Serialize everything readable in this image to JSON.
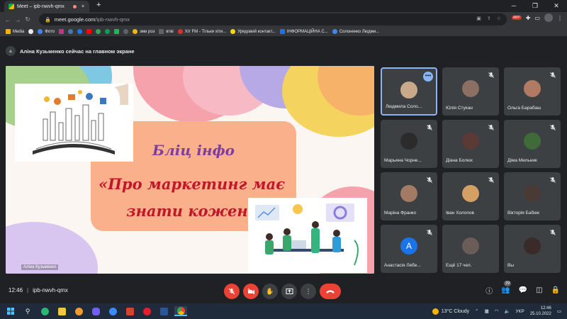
{
  "browser": {
    "tab_title": "Meet – ipb-nwvh-qmx",
    "tab_close": "×",
    "new_tab": "+",
    "url_host": "meet.google.com",
    "url_path": "/ipb-nwvh-qmx",
    "window_controls": [
      "─",
      "❐",
      "✕"
    ],
    "ext_badge": "ABP"
  },
  "bookmarks": [
    {
      "label": "Media",
      "color": "#f4b400"
    },
    {
      "label": "",
      "color": "#e8eaed"
    },
    {
      "label": "Фото",
      "color": "#4285f4"
    },
    {
      "label": "",
      "color": "#c13584"
    },
    {
      "label": "",
      "color": "#4a76a8"
    },
    {
      "label": "",
      "color": "#1877f2"
    },
    {
      "label": "",
      "color": "#ff0000"
    },
    {
      "label": "",
      "color": "#34a853"
    },
    {
      "label": "",
      "color": "#0f9d58"
    },
    {
      "label": "",
      "color": "#1db954"
    },
    {
      "label": "",
      "color": "#5f6368"
    },
    {
      "label": "зми роз",
      "color": "#f4b400"
    },
    {
      "label": "втві",
      "color": "#5f6368"
    },
    {
      "label": "Хіт FM - Тільки хіти...",
      "color": "#d93025"
    },
    {
      "label": "Урядовий контакт...",
      "color": "#ffd700"
    },
    {
      "label": "ІНФОРМАЦІЙНА С...",
      "color": "#1a73e8"
    },
    {
      "label": "Солоненко Людми...",
      "color": "#4285f4"
    }
  ],
  "meet": {
    "presenter_text": "Аліна Кузьменко сейчас на главном экране",
    "slide": {
      "title_line1": "Бліц інфо",
      "title_line2": "«Про маркетинг має",
      "title_line3": "знати кожен»",
      "caption": "Аліна Кузьменко"
    },
    "participants": [
      {
        "name": "Людмила Соло...",
        "face": "#c9a98a",
        "active": true,
        "muted": false
      },
      {
        "name": "Юлія Стукан",
        "face": "#8a6f62",
        "active": false,
        "muted": true
      },
      {
        "name": "Ольга Барабаш",
        "face": "#b07a63",
        "active": false,
        "muted": true
      },
      {
        "name": "Марьяна Чорне...",
        "face": "#2b2b2b",
        "active": false,
        "muted": true
      },
      {
        "name": "Діана Болюх",
        "face": "#5b3a35",
        "active": false,
        "muted": true
      },
      {
        "name": "Діма Мельник",
        "face": "#3f6b3a",
        "active": false,
        "muted": true
      },
      {
        "name": "Маріна Франко",
        "face": "#a37b64",
        "active": false,
        "muted": true
      },
      {
        "name": "Іван Холопов",
        "face": "#d4a064",
        "active": false,
        "muted": true
      },
      {
        "name": "Вікторія Бабюк",
        "face": "#4a3a35",
        "active": false,
        "muted": true
      },
      {
        "name": "Анастасія Лебе...",
        "letter": "A",
        "active": false,
        "muted": true
      },
      {
        "name": "Ещё 17 чел.",
        "face": "#6b5c58",
        "active": false,
        "muted": false
      },
      {
        "name": "Вы",
        "face": "#3a2a2a",
        "active": false,
        "muted": true
      }
    ],
    "clock": "12:46",
    "separator": "|",
    "meeting_code": "ipb-nwvh-qmx",
    "participant_count": "29"
  },
  "taskbar": {
    "weather": "13°C Cloudy",
    "lang": "УКР",
    "time": "12:46",
    "date": "25.10.2022"
  },
  "colors": {
    "end_call": "#ea4335",
    "active_border": "#8ab4f8",
    "tile_bg": "#3c4043"
  }
}
